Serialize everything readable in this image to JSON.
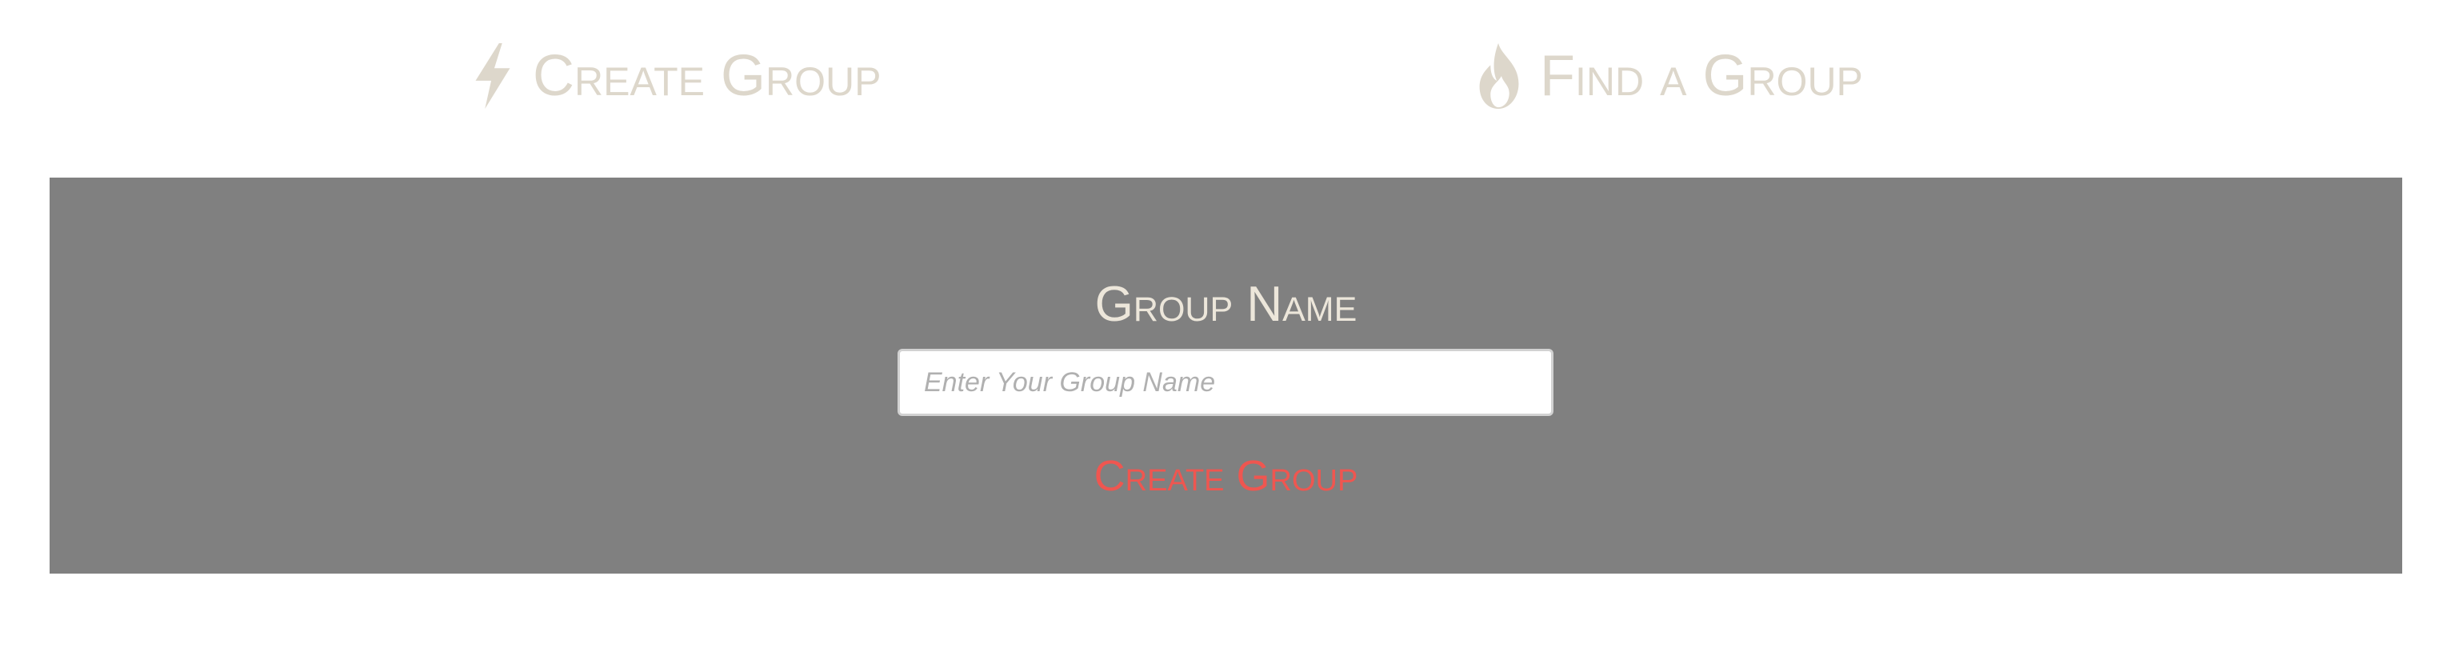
{
  "nav": {
    "items": [
      {
        "label": "Create Group",
        "icon": "bolt-icon"
      },
      {
        "label": "Find a Group",
        "icon": "fire-icon"
      }
    ]
  },
  "panel": {
    "title": "Group Name",
    "input": {
      "value": "",
      "placeholder": "Enter Your Group Name"
    },
    "submit_label": "Create Group"
  },
  "colors": {
    "nav_text": "#ddd7cb",
    "panel_background": "#808080",
    "panel_title": "#ece6da",
    "accent": "#ef5650"
  }
}
